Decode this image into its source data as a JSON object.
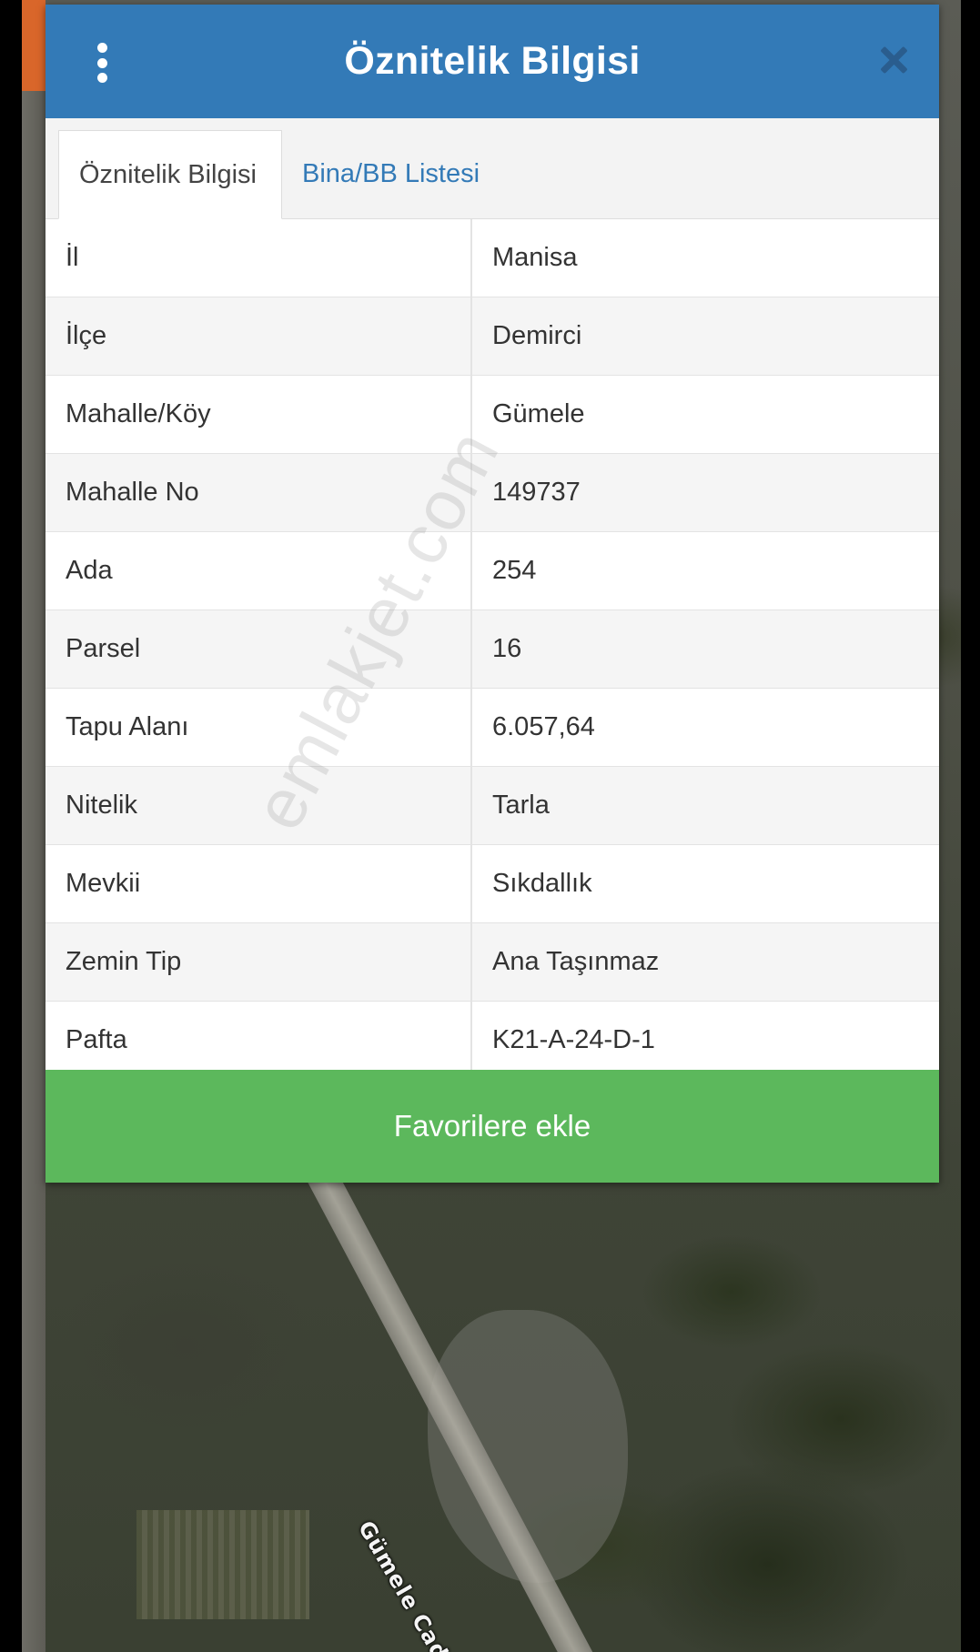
{
  "dialog": {
    "title": "Öznitelik Bilgisi",
    "tabs": [
      {
        "label": "Öznitelik Bilgisi",
        "active": true
      },
      {
        "label": "Bina/BB Listesi",
        "active": false
      }
    ],
    "rows": [
      {
        "key": "İl",
        "value": "Manisa"
      },
      {
        "key": "İlçe",
        "value": "Demirci"
      },
      {
        "key": "Mahalle/Köy",
        "value": "Gümele"
      },
      {
        "key": "Mahalle No",
        "value": "149737"
      },
      {
        "key": "Ada",
        "value": "254"
      },
      {
        "key": "Parsel",
        "value": "16"
      },
      {
        "key": "Tapu Alanı",
        "value": "6.057,64"
      },
      {
        "key": "Nitelik",
        "value": "Tarla"
      },
      {
        "key": "Mevkii",
        "value": "Sıkdallık"
      },
      {
        "key": "Zemin Tip",
        "value": "Ana Taşınmaz"
      },
      {
        "key": "Pafta",
        "value": "K21-A-24-D-1"
      }
    ],
    "favorite_button_label": "Favorilere ekle",
    "menu_icon": "more-vertical-icon",
    "close_icon": "close-icon"
  },
  "map": {
    "road_label": "Gümele Cadde"
  },
  "watermark": "emlakjet.com",
  "colors": {
    "header": "#337ab7",
    "tab_link": "#337ab7",
    "favorite_button": "#5cb85c",
    "accent_orange": "#d9662a"
  }
}
